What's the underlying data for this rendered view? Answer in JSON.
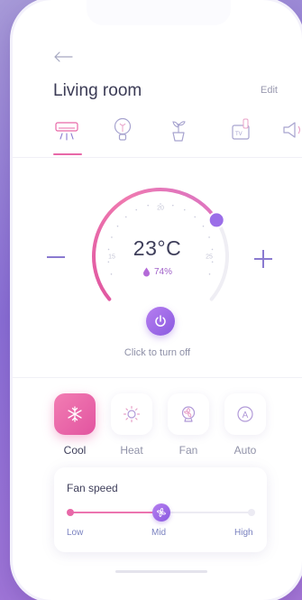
{
  "header": {
    "title": "Living room",
    "edit_label": "Edit"
  },
  "devices": [
    {
      "icon": "air-conditioner-icon",
      "active": true
    },
    {
      "icon": "light-bulb-icon",
      "active": false
    },
    {
      "icon": "plant-icon",
      "active": false
    },
    {
      "icon": "tv-icon",
      "active": false,
      "text": "TV"
    },
    {
      "icon": "speaker-icon",
      "active": false
    }
  ],
  "thermostat": {
    "temperature": "23°C",
    "humidity": "74%",
    "scale_labels": [
      "15",
      "20",
      "25"
    ],
    "level_fraction": 0.72,
    "power_hint": "Click to turn off"
  },
  "modes": [
    {
      "label": "Cool",
      "icon": "snowflake-icon",
      "active": true
    },
    {
      "label": "Heat",
      "icon": "sun-icon",
      "active": false
    },
    {
      "label": "Fan",
      "icon": "fan-icon",
      "active": false
    },
    {
      "label": "Auto",
      "icon": "auto-icon",
      "active": false,
      "glyph": "A"
    }
  ],
  "fan_speed": {
    "title": "Fan speed",
    "low_label": "Low",
    "mid_label": "Mid",
    "high_label": "High",
    "level_fraction": 0.5
  },
  "colors": {
    "accent_pink": "#e868a8",
    "accent_purple": "#8a5ae0",
    "text_dark": "#3e3e5a"
  }
}
